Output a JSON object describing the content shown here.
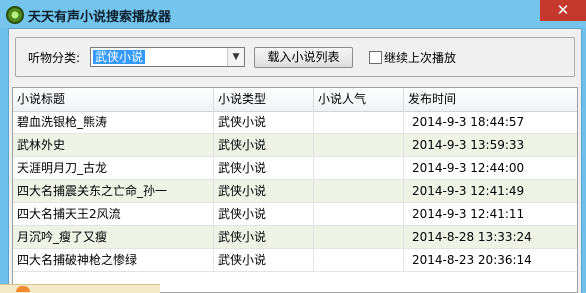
{
  "window": {
    "title": "天天有声小说搜索播放器",
    "close_icon": "close-icon",
    "app_icon": "app-icon"
  },
  "toolbar": {
    "category_label": "听物分类:",
    "category_selected": "武侠小说",
    "load_button": "载入小说列表",
    "resume_label": "继续上次播放",
    "resume_checked": false
  },
  "table": {
    "columns": [
      "小说标题",
      "小说类型",
      "小说人气",
      "发布时间"
    ],
    "rows": [
      {
        "title": "碧血洗银枪_熊涛",
        "type": "武侠小说",
        "popularity": "",
        "date": "2014-9-3 18:44:57"
      },
      {
        "title": "武林外史",
        "type": "武侠小说",
        "popularity": "",
        "date": "2014-9-3 13:59:33"
      },
      {
        "title": "天涯明月刀_古龙",
        "type": "武侠小说",
        "popularity": "",
        "date": "2014-9-3 12:44:00"
      },
      {
        "title": "四大名捕震关东之亡命_孙一",
        "type": "武侠小说",
        "popularity": "",
        "date": "2014-9-3 12:41:49"
      },
      {
        "title": "四大名捕天王2风流",
        "type": "武侠小说",
        "popularity": "",
        "date": "2014-9-3 12:41:11"
      },
      {
        "title": "月沉吟_瘦了又瘦",
        "type": "武侠小说",
        "popularity": "",
        "date": "2014-8-28 13:33:24"
      },
      {
        "title": "四大名捕破神枪之惨绿",
        "type": "武侠小说",
        "popularity": "",
        "date": "2014-8-23 20:36:14"
      }
    ]
  }
}
